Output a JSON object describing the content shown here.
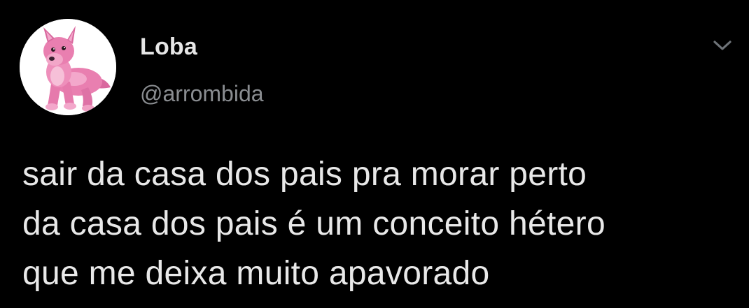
{
  "tweet": {
    "author": {
      "display_name": "Loba",
      "handle": "@arrombida",
      "avatar_icon": "pink-wolf-plush-avatar"
    },
    "menu_icon": "chevron-down-icon",
    "text": "sair da casa dos pais pra morar perto\nda casa dos pais é um conceito hétero\nque me deixa muito apavorado"
  },
  "colors": {
    "background": "#000000",
    "text_primary": "#e6e6e6",
    "text_secondary": "#8a8d91",
    "avatar_background": "#ffffff",
    "avatar_plush_pink": "#e97fb0"
  }
}
